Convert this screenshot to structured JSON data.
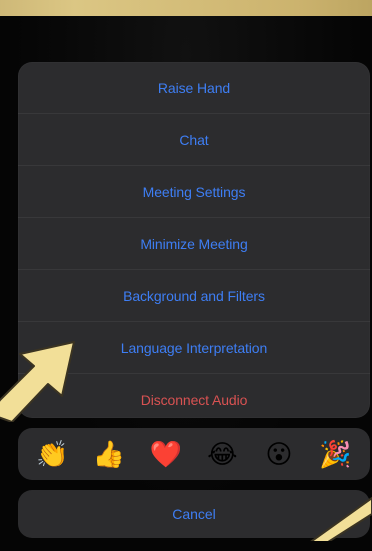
{
  "menu": {
    "items": [
      {
        "label": "Raise Hand",
        "type": "normal"
      },
      {
        "label": "Chat",
        "type": "normal"
      },
      {
        "label": "Meeting Settings",
        "type": "normal"
      },
      {
        "label": "Minimize Meeting",
        "type": "normal"
      },
      {
        "label": "Background and Filters",
        "type": "normal"
      },
      {
        "label": "Language Interpretation",
        "type": "normal"
      },
      {
        "label": "Disconnect Audio",
        "type": "danger"
      }
    ]
  },
  "reactions": {
    "items": [
      {
        "emoji": "👏",
        "icon": "clapping-hands-icon"
      },
      {
        "emoji": "👍",
        "icon": "thumbs-up-icon"
      },
      {
        "emoji": "❤️",
        "icon": "heart-icon"
      },
      {
        "emoji": "😂",
        "icon": "tears-of-joy-icon"
      },
      {
        "emoji": "😮",
        "icon": "surprised-face-icon"
      },
      {
        "emoji": "🎉",
        "icon": "party-popper-icon"
      }
    ]
  },
  "cancel": {
    "label": "Cancel"
  },
  "colors": {
    "accent": "#3e7ef4",
    "danger": "#d85252",
    "sheet": "#2c2c2e",
    "annotation_arrow": "#f2df98"
  }
}
